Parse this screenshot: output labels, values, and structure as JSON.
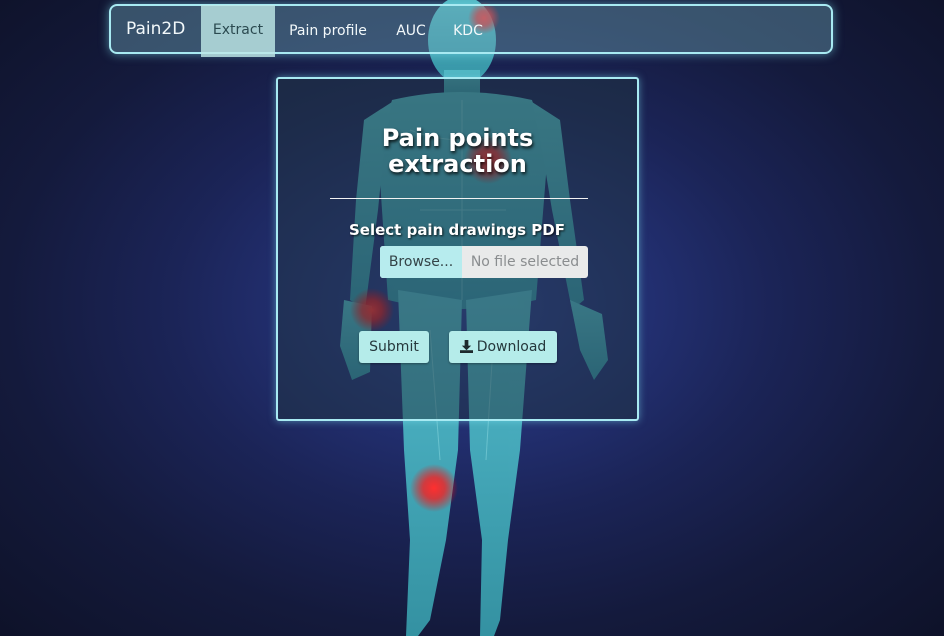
{
  "navbar": {
    "brand": "Pain2D",
    "items": [
      {
        "label": "Extract",
        "active": true
      },
      {
        "label": "Pain profile",
        "active": false
      },
      {
        "label": "AUC",
        "active": false
      },
      {
        "label": "KDC",
        "active": false
      }
    ]
  },
  "card": {
    "title_line1": "Pain points",
    "title_line2": "extraction",
    "file_label": "Select pain drawings PDF",
    "browse_label": "Browse...",
    "file_status": "No file selected",
    "submit_label": "Submit",
    "download_label": "Download",
    "download_icon": "download-icon"
  },
  "colors": {
    "accent_border": "#a8eaf2",
    "button_bg": "#b5ecea",
    "pain_marker": "#ff2020",
    "background": "#1b2457"
  }
}
